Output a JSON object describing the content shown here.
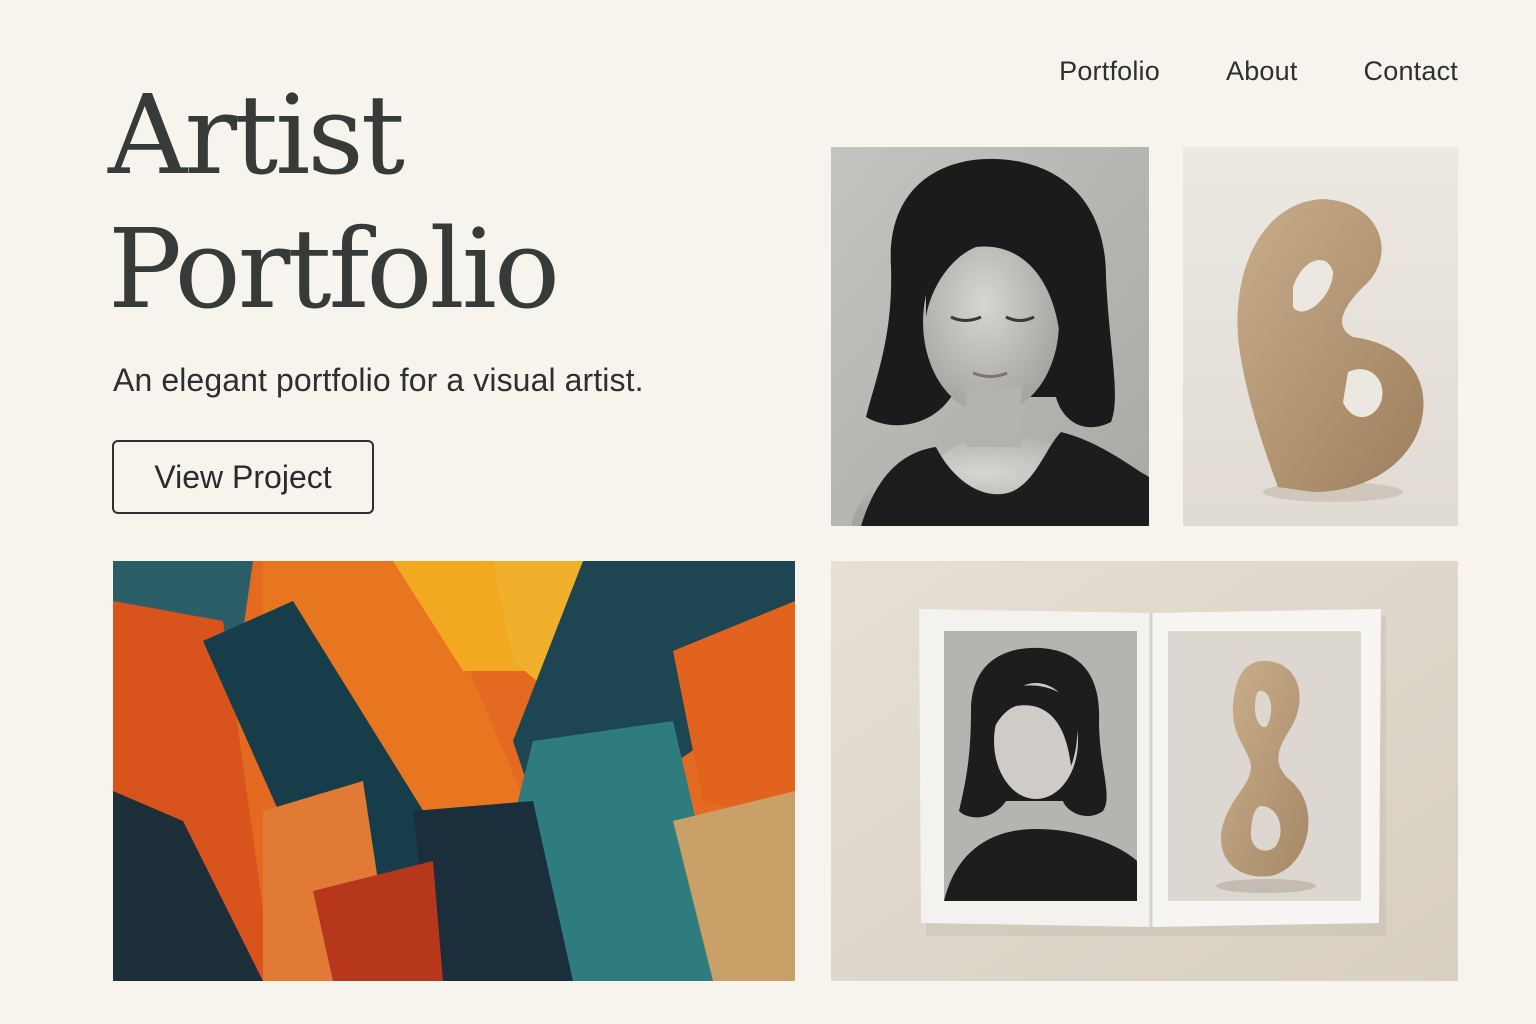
{
  "nav": {
    "items": [
      {
        "label": "Portfolio"
      },
      {
        "label": "About"
      },
      {
        "label": "Contact"
      }
    ]
  },
  "hero": {
    "title_line1": "Artist",
    "title_line2": "Portfolio",
    "subtitle": "An elegant portfolio for a visual artist.",
    "cta_label": "View Project"
  },
  "colors": {
    "background": "#f7f4ee",
    "text": "#363a38",
    "painting_orange": "#e46a22",
    "painting_teal": "#1e4a55",
    "painting_yellow": "#f0a21e",
    "sculpture_clay": "#b99b78"
  },
  "gallery": {
    "items": [
      {
        "name": "portrait-photo",
        "kind": "black-and-white portrait"
      },
      {
        "name": "sculpture-photo",
        "kind": "clay sculpture"
      },
      {
        "name": "abstract-painting",
        "kind": "abstract brushstroke painting"
      },
      {
        "name": "open-book-photo",
        "kind": "printed book spread"
      }
    ]
  }
}
